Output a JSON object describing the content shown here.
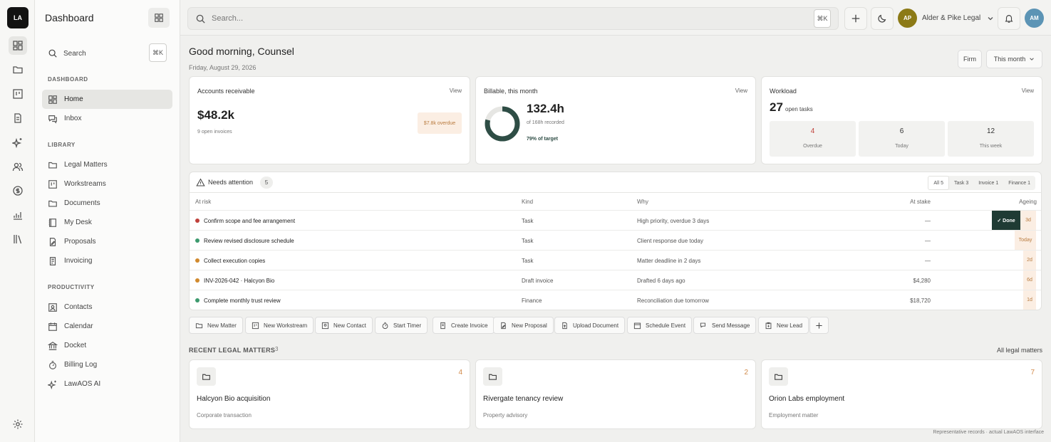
{
  "rail": {
    "logo": "LA"
  },
  "sidebar": {
    "title": "Dashboard",
    "search_label": "Search",
    "search_kbd": "⌘K",
    "sections": {
      "dashboard": "DASHBOARD",
      "library": "LIBRARY",
      "productivity": "PRODUCTIVITY"
    },
    "items": {
      "home": "Home",
      "inbox": "Inbox",
      "legal_matters": "Legal Matters",
      "workstreams": "Workstreams",
      "documents": "Documents",
      "my_desk": "My Desk",
      "proposals": "Proposals",
      "invoicing": "Invoicing",
      "contacts": "Contacts",
      "calendar": "Calendar",
      "docket": "Docket",
      "billing_log": "Billing Log",
      "lawaos_ai": "LawAOS AI"
    }
  },
  "topbar": {
    "search_placeholder": "Search...",
    "search_kbd": "⌘K",
    "firm_initials": "AP",
    "firm_name": "Alder & Pike Legal",
    "user_initials": "AM"
  },
  "header": {
    "greeting": "Good morning, Counsel",
    "date": "Friday, August 29, 2026",
    "scope": "Firm",
    "period": "This month"
  },
  "cards": {
    "ar": {
      "title": "Accounts receivable",
      "view": "View",
      "value": "$48.2k",
      "sub": "9 open invoices",
      "overdue": "$7.8k overdue"
    },
    "billable": {
      "title": "Billable, this month",
      "view": "View",
      "value": "132.4h",
      "sub": "of 168h recorded",
      "target": "79% of target",
      "progress": 0.79
    },
    "workload": {
      "title": "Workload",
      "view": "View",
      "count": "27",
      "count_label": "open tasks",
      "boxes": [
        {
          "n": "4",
          "l": "Overdue"
        },
        {
          "n": "6",
          "l": "Today"
        },
        {
          "n": "12",
          "l": "This week"
        }
      ]
    }
  },
  "attention": {
    "title": "Needs attention",
    "count": "5",
    "filters": [
      "All 5",
      "Task 3",
      "Invoice 1",
      "Finance 1"
    ],
    "columns": {
      "risk": "At risk",
      "kind": "Kind",
      "why": "Why",
      "stake": "At stake",
      "ageing": "Ageing"
    },
    "rows": [
      {
        "title": "Confirm scope and fee arrangement",
        "kind": "Task",
        "why": "High priority, overdue 3 days",
        "stake": "—",
        "ageing": "3d",
        "dot": "#c0413b"
      },
      {
        "title": "Review revised disclosure schedule",
        "kind": "Task",
        "why": "Client response due today",
        "stake": "—",
        "ageing": "Today",
        "dot": "#3d9a6e"
      },
      {
        "title": "Collect execution copies",
        "kind": "Task",
        "why": "Matter deadline in 2 days",
        "stake": "—",
        "ageing": "2d",
        "dot": "#d18a2e"
      },
      {
        "title": "INV-2026-042 · Halcyon Bio",
        "kind": "Draft invoice",
        "why": "Drafted 6 days ago",
        "stake": "$4,280",
        "ageing": "6d",
        "dot": "#d18a2e"
      },
      {
        "title": "Complete monthly trust review",
        "kind": "Finance",
        "why": "Reconciliation due tomorrow",
        "stake": "$18,720",
        "ageing": "1d",
        "dot": "#3d9a6e"
      }
    ],
    "done_label": "✓ Done"
  },
  "quick_actions": [
    "New Matter",
    "New Workstream",
    "New Contact",
    "Start Timer",
    "Create Invoice",
    "New Proposal",
    "Upload Document",
    "Schedule Event",
    "Send Message",
    "New Lead"
  ],
  "recent": {
    "title": "RECENT LEGAL MATTERS",
    "count": "3",
    "all": "All legal matters",
    "items": [
      {
        "name": "Halcyon Bio acquisition",
        "sub": "Corporate transaction",
        "count": "4"
      },
      {
        "name": "Rivergate tenancy review",
        "sub": "Property advisory",
        "count": "2"
      },
      {
        "name": "Orion Labs employment",
        "sub": "Employment matter",
        "count": "7"
      }
    ]
  },
  "footer": "Representative records · actual LawAOS interface"
}
